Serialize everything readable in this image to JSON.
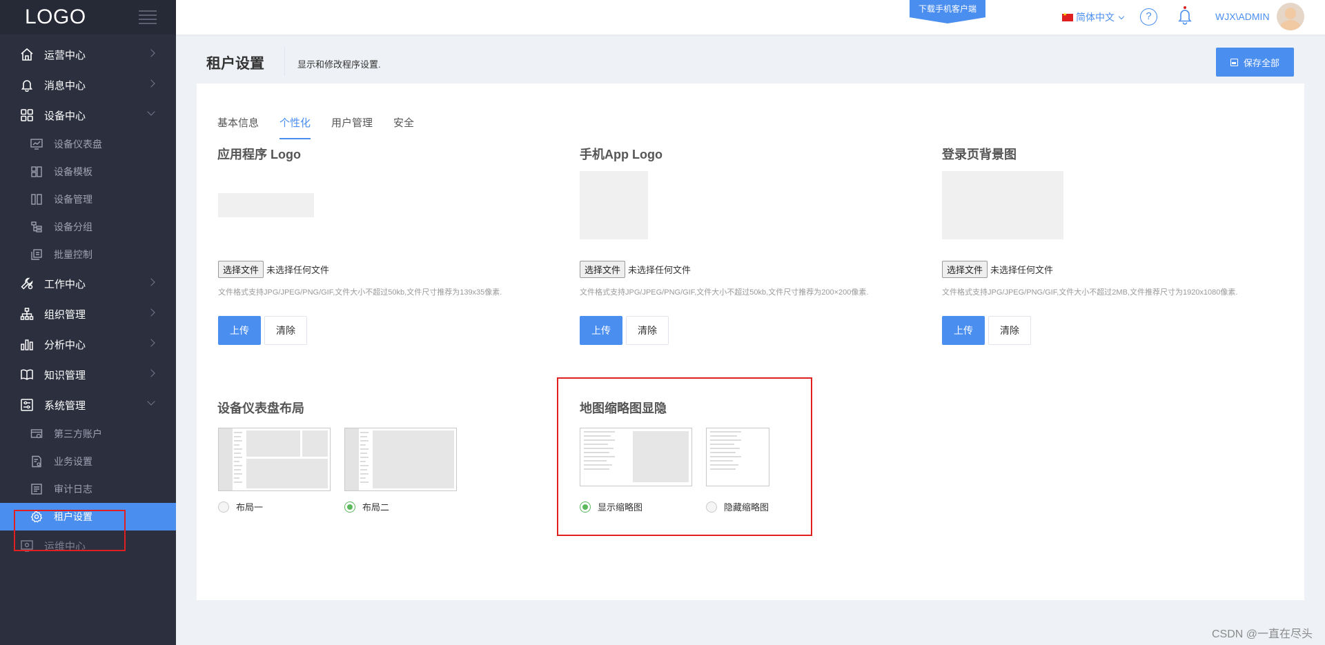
{
  "sidebar": {
    "logo": "LOGO",
    "menu": {
      "ops_center": "运营中心",
      "msg_center": "消息中心",
      "device_center": "设备中心",
      "device_dashboard": "设备仪表盘",
      "device_template": "设备模板",
      "device_manage": "设备管理",
      "device_group": "设备分组",
      "batch_control": "批量控制",
      "work_center": "工作中心",
      "org_manage": "组织管理",
      "analysis_center": "分析中心",
      "knowledge_manage": "知识管理",
      "system_manage": "系统管理",
      "third_party": "第三方账户",
      "business_settings": "业务设置",
      "audit_log": "审计日志",
      "tenant_settings": "租户设置",
      "ops_maint_center": "运维中心"
    }
  },
  "topbar": {
    "download_banner": "下载手机客户端",
    "language": "简体中文",
    "help": "?",
    "username": "WJX\\ADMIN"
  },
  "header": {
    "title": "租户设置",
    "description": "显示和修改程序设置.",
    "save_all": "保存全部"
  },
  "tabs": [
    "基本信息",
    "个性化",
    "用户管理",
    "安全"
  ],
  "uploads": {
    "app_logo": {
      "title": "应用程序 Logo",
      "choose": "选择文件",
      "no_file": "未选择任何文件",
      "hint": "文件格式支持JPG/JPEG/PNG/GIF,文件大小不超过50kb,文件尺寸推荐为139x35像素.",
      "upload": "上传",
      "clear": "清除"
    },
    "mobile_logo": {
      "title": "手机App Logo",
      "choose": "选择文件",
      "no_file": "未选择任何文件",
      "hint": "文件格式支持JPG/JPEG/PNG/GIF,文件大小不超过50kb,文件尺寸推荐为200×200像素.",
      "upload": "上传",
      "clear": "清除"
    },
    "login_bg": {
      "title": "登录页背景图",
      "choose": "选择文件",
      "no_file": "未选择任何文件",
      "hint": "文件格式支持JPG/JPEG/PNG/GIF,文件大小不超过2MB,文件推荐尺寸为1920x1080像素.",
      "upload": "上传",
      "clear": "清除"
    }
  },
  "dashboard_layout": {
    "title": "设备仪表盘布局",
    "option1": "布局一",
    "option2": "布局二",
    "selected": "布局二"
  },
  "map_thumbnail": {
    "title": "地图缩略图显隐",
    "show": "显示缩略图",
    "hide": "隐藏缩略图",
    "selected": "显示缩略图"
  },
  "watermark": "CSDN @一直在尽头",
  "colors": {
    "primary": "#4a8ef0",
    "sidebar": "#2c2f3e",
    "highlight": "#e02020",
    "radio_checked": "#5cb85c"
  }
}
